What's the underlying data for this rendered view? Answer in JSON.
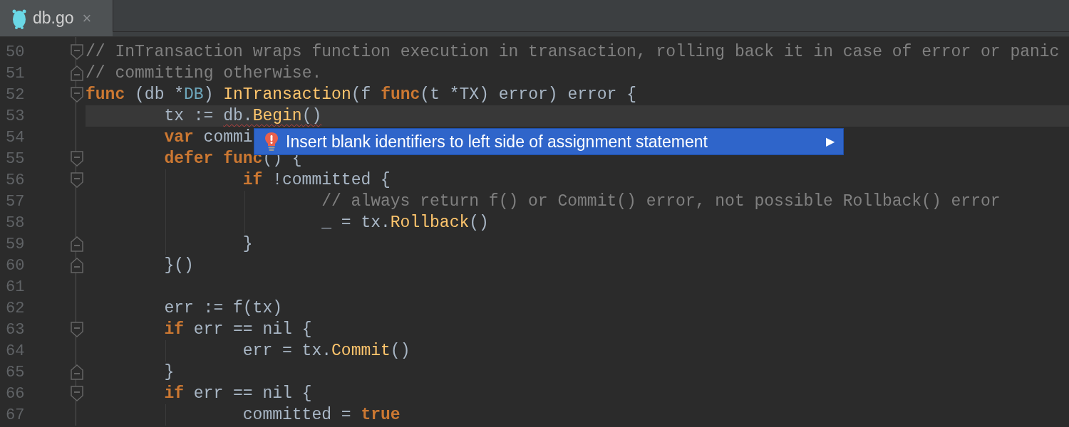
{
  "tabs": [
    {
      "label": "db.go",
      "close": "×",
      "selected": true
    }
  ],
  "lines": [
    {
      "number": "50",
      "fold_open": true,
      "tokens": [
        {
          "kind": "comment",
          "text": "// InTransaction wraps function execution in transaction, rolling back it in case of error or panic"
        }
      ]
    },
    {
      "number": "51",
      "fold_close": true,
      "tokens": [
        {
          "kind": "comment",
          "text": "// committing otherwise."
        }
      ]
    },
    {
      "number": "52",
      "fold_open": true,
      "tokens": [
        {
          "kind": "kw",
          "text": "func"
        },
        {
          "kind": "plain",
          "text": " (db *"
        },
        {
          "kind": "type",
          "text": "DB"
        },
        {
          "kind": "plain",
          "text": ") "
        },
        {
          "kind": "fn",
          "text": "InTransaction"
        },
        {
          "kind": "plain",
          "text": "(f "
        },
        {
          "kind": "kw",
          "text": "func"
        },
        {
          "kind": "plain",
          "text": "(t *TX) error) error {"
        }
      ],
      "children": [
        {
          "number": "53",
          "current": true,
          "tokens": [
            {
              "kind": "plain",
              "text": "tx := "
            },
            {
              "kind": "plain",
              "text": "db.",
              "warning": true
            },
            {
              "kind": "fn",
              "text": "Begin",
              "warning": true
            },
            {
              "kind": "plain",
              "text": "()",
              "warning": true
            }
          ]
        },
        {
          "number": "54",
          "tokens": [
            {
              "kind": "kw",
              "text": "var"
            },
            {
              "kind": "plain",
              "text": " commi"
            }
          ]
        },
        {
          "number": "55",
          "fold_open": true,
          "tokens": [
            {
              "kind": "kw",
              "text": "defer func"
            },
            {
              "kind": "plain",
              "text": "() {"
            }
          ],
          "children": [
            {
              "number": "56",
              "fold_open": true,
              "tokens": [
                {
                  "kind": "kw",
                  "text": "if"
                },
                {
                  "kind": "plain",
                  "text": " !committed {"
                }
              ],
              "children": [
                {
                  "number": "57",
                  "tokens": [
                    {
                      "kind": "comment",
                      "text": "// always return f() or Commit() error, not possible Rollback() error"
                    }
                  ]
                },
                {
                  "number": "58",
                  "tokens": [
                    {
                      "kind": "plain",
                      "text": "_ = tx."
                    },
                    {
                      "kind": "fn",
                      "text": "Rollback"
                    },
                    {
                      "kind": "plain",
                      "text": "()"
                    }
                  ]
                }
              ]
            },
            {
              "number": "59",
              "fold_close": true,
              "tokens": [
                {
                  "kind": "plain",
                  "text": "}"
                }
              ]
            }
          ]
        },
        {
          "number": "60",
          "fold_close": true,
          "tokens": [
            {
              "kind": "plain",
              "text": "}()"
            }
          ]
        },
        {
          "number": "61"
        },
        {
          "number": "62",
          "tokens": [
            {
              "kind": "plain",
              "text": "err := f(tx)"
            }
          ]
        },
        {
          "number": "63",
          "fold_open": true,
          "tokens": [
            {
              "kind": "kw",
              "text": "if"
            },
            {
              "kind": "plain",
              "text": " err == nil {"
            }
          ],
          "children": [
            {
              "number": "64",
              "tokens": [
                {
                  "kind": "plain",
                  "text": "err = tx."
                },
                {
                  "kind": "fn",
                  "text": "Commit"
                },
                {
                  "kind": "plain",
                  "text": "()"
                }
              ]
            }
          ]
        },
        {
          "number": "65",
          "fold_close": true,
          "tokens": [
            {
              "kind": "plain",
              "text": "}"
            }
          ]
        },
        {
          "number": "66",
          "fold_open": true,
          "tokens": [
            {
              "kind": "kw",
              "text": "if"
            },
            {
              "kind": "plain",
              "text": " err == nil {"
            }
          ],
          "children": [
            {
              "number": "67",
              "tokens": [
                {
                  "kind": "plain",
                  "text": "committed = "
                },
                {
                  "kind": "kw",
                  "text": "true"
                }
              ]
            }
          ]
        }
      ]
    }
  ],
  "popup": {
    "text": "Insert blank identifiers to left side of assignment statement",
    "arrow": "▶"
  }
}
